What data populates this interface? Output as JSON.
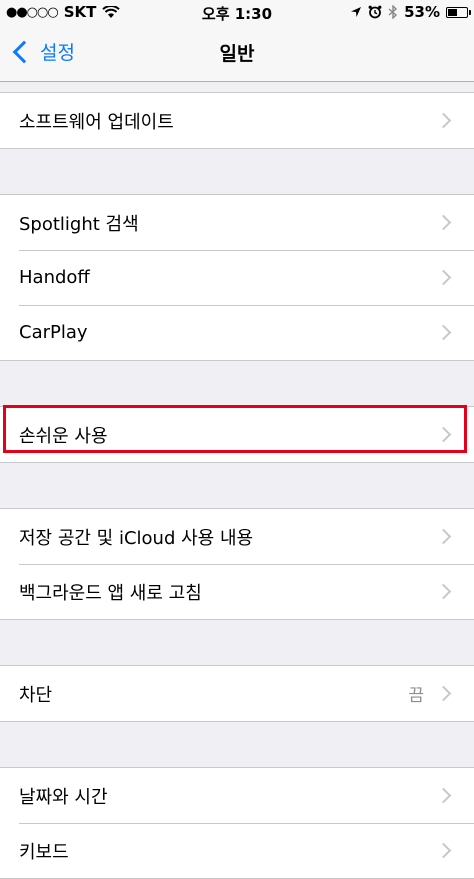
{
  "status_bar": {
    "signal": "●●○○○",
    "carrier": "SKT",
    "time": "오후 1:30",
    "battery_percent": "53%",
    "battery_level": 0.53
  },
  "navbar": {
    "back_label": "설정",
    "title": "일반"
  },
  "groups": [
    {
      "rows": [
        {
          "label": "소프트웨어 업데이트"
        }
      ]
    },
    {
      "rows": [
        {
          "label": "Spotlight 검색"
        },
        {
          "label": "Handoff"
        },
        {
          "label": "CarPlay"
        }
      ]
    },
    {
      "rows": [
        {
          "label": "손쉬운 사용"
        }
      ]
    },
    {
      "rows": [
        {
          "label": "저장 공간 및 iCloud 사용 내용"
        },
        {
          "label": "백그라운드 앱 새로 고침"
        }
      ]
    },
    {
      "rows": [
        {
          "label": "차단",
          "detail": "끔"
        }
      ]
    },
    {
      "rows": [
        {
          "label": "날짜와 시간"
        },
        {
          "label": "키보드"
        }
      ]
    }
  ],
  "colors": {
    "accent": "#0a7aff",
    "highlight": "#e50019"
  }
}
